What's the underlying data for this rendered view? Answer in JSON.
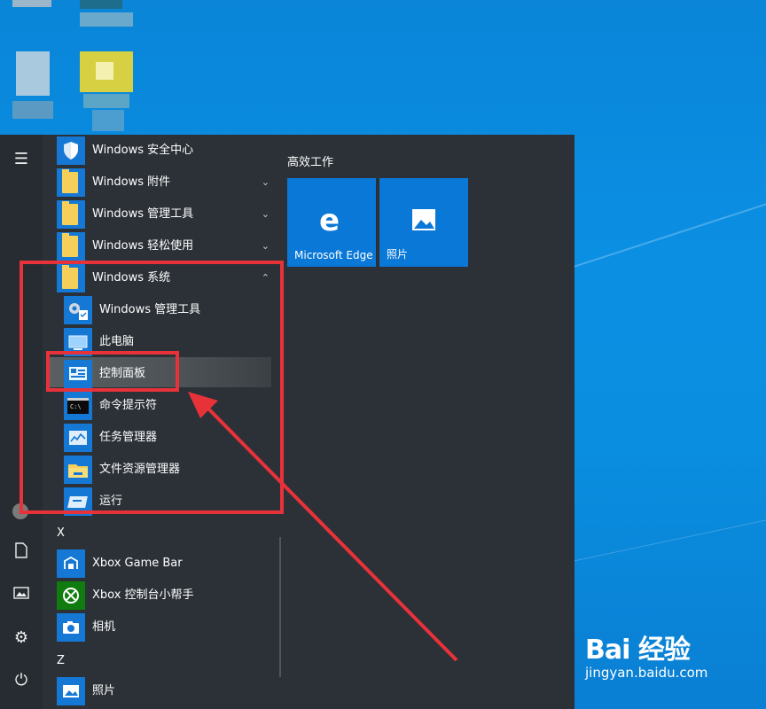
{
  "app_list": {
    "items": [
      {
        "label": "Windows 安全中心",
        "icon": "shield-icon",
        "chevron": ""
      },
      {
        "label": "Windows 附件",
        "icon": "folder-icon",
        "chevron": "⌄"
      },
      {
        "label": "Windows 管理工具",
        "icon": "folder-icon",
        "chevron": "⌄"
      },
      {
        "label": "Windows 轻松使用",
        "icon": "folder-icon",
        "chevron": "⌄"
      },
      {
        "label": "Windows 系统",
        "icon": "folder-icon",
        "chevron": "⌃"
      }
    ],
    "system_items": [
      {
        "label": "Windows 管理工具",
        "icon": "admin-tools-icon"
      },
      {
        "label": "此电脑",
        "icon": "computer-icon"
      },
      {
        "label": "控制面板",
        "icon": "control-panel-icon"
      },
      {
        "label": "命令提示符",
        "icon": "command-prompt-icon"
      },
      {
        "label": "任务管理器",
        "icon": "task-manager-icon"
      },
      {
        "label": "文件资源管理器",
        "icon": "file-explorer-icon"
      },
      {
        "label": "运行",
        "icon": "run-icon"
      }
    ],
    "letter_x": "X",
    "x_items": [
      {
        "label": "Xbox Game Bar",
        "icon": "xbox-game-bar-icon"
      },
      {
        "label": "Xbox 控制台小帮手",
        "icon": "xbox-icon"
      },
      {
        "label": "相机",
        "icon": "camera-icon"
      }
    ],
    "letter_z": "Z",
    "z_items": [
      {
        "label": "照片",
        "icon": "photos-icon"
      }
    ]
  },
  "tiles": {
    "group_title": "高效工作",
    "items": [
      {
        "label": "Microsoft Edge",
        "icon": "edge-icon"
      },
      {
        "label": "照片",
        "icon": "photos-icon"
      }
    ]
  },
  "watermark": {
    "brand": "Bai 经验",
    "url": "jingyan.baidu.com"
  },
  "colors": {
    "desktop": "#0a8fe0",
    "start_bg": "#2b3137",
    "tile_blue": "#0a78d7",
    "annotation_red": "#e8323a"
  }
}
